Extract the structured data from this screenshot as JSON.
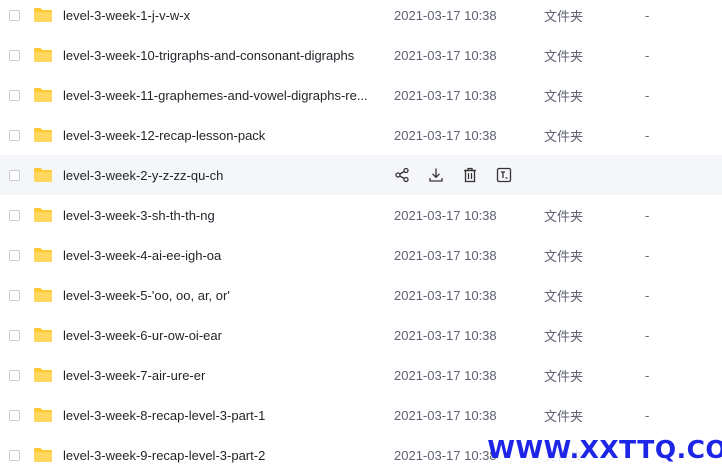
{
  "files": [
    {
      "name": "level-3-week-1-j-v-w-x",
      "date": "2021-03-17 10:38",
      "type": "文件夹",
      "size": "-"
    },
    {
      "name": "level-3-week-10-trigraphs-and-consonant-digraphs",
      "date": "2021-03-17 10:38",
      "type": "文件夹",
      "size": "-"
    },
    {
      "name": "level-3-week-11-graphemes-and-vowel-digraphs-re...",
      "date": "2021-03-17 10:38",
      "type": "文件夹",
      "size": "-"
    },
    {
      "name": "level-3-week-12-recap-lesson-pack",
      "date": "2021-03-17 10:38",
      "type": "文件夹",
      "size": "-"
    },
    {
      "name": "level-3-week-2-y-z-zz-qu-ch",
      "date": "",
      "type": "",
      "size": ""
    },
    {
      "name": "level-3-week-3-sh-th-th-ng",
      "date": "2021-03-17 10:38",
      "type": "文件夹",
      "size": "-"
    },
    {
      "name": "level-3-week-4-ai-ee-igh-oa",
      "date": "2021-03-17 10:38",
      "type": "文件夹",
      "size": "-"
    },
    {
      "name": "level-3-week-5-'oo, oo, ar, or'",
      "date": "2021-03-17 10:38",
      "type": "文件夹",
      "size": "-"
    },
    {
      "name": "level-3-week-6-ur-ow-oi-ear",
      "date": "2021-03-17 10:38",
      "type": "文件夹",
      "size": "-"
    },
    {
      "name": "level-3-week-7-air-ure-er",
      "date": "2021-03-17 10:38",
      "type": "文件夹",
      "size": "-"
    },
    {
      "name": "level-3-week-8-recap-level-3-part-1",
      "date": "2021-03-17 10:38",
      "type": "文件夹",
      "size": "-"
    },
    {
      "name": "level-3-week-9-recap-level-3-part-2",
      "date": "2021-03-17 10:38",
      "type": "文件夹",
      "size": "-"
    }
  ],
  "hover_row_index": 4,
  "hover_actions": [
    "share-icon",
    "download-icon",
    "delete-icon",
    "rename-icon"
  ],
  "colors": {
    "folder": "#ffc933",
    "hover_bg": "#f5f6fa",
    "watermark": "#1d25e6"
  },
  "watermark": "WWW.XXTTQ.COM"
}
